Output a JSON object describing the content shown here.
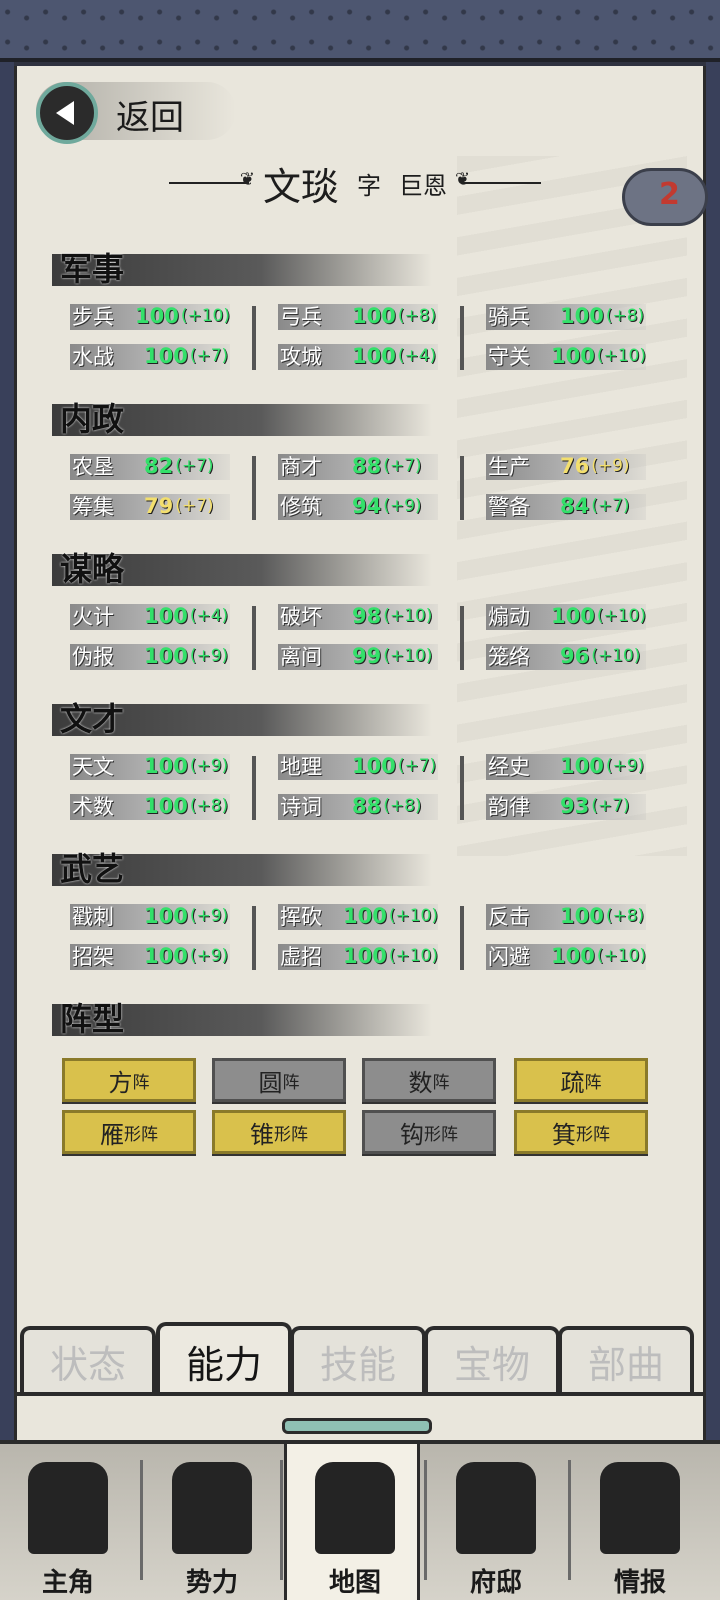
{
  "nav": {
    "back_label": "返回"
  },
  "character": {
    "name": "文琰",
    "courtesy_prefix": "字",
    "courtesy_name": "巨恩",
    "badge_number": "2"
  },
  "sections": [
    {
      "title": "军事",
      "stats": [
        {
          "label": "步兵",
          "value": "100",
          "bonus": "(+10)",
          "color": "green"
        },
        {
          "label": "弓兵",
          "value": "100",
          "bonus": "(+8)",
          "color": "green"
        },
        {
          "label": "骑兵",
          "value": "100",
          "bonus": "(+8)",
          "color": "green"
        },
        {
          "label": "水战",
          "value": "100",
          "bonus": "(+7)",
          "color": "green"
        },
        {
          "label": "攻城",
          "value": "100",
          "bonus": "(+4)",
          "color": "green"
        },
        {
          "label": "守关",
          "value": "100",
          "bonus": "(+10)",
          "color": "green"
        }
      ]
    },
    {
      "title": "内政",
      "stats": [
        {
          "label": "农垦",
          "value": "82",
          "bonus": "(+7)",
          "color": "green"
        },
        {
          "label": "商才",
          "value": "88",
          "bonus": "(+7)",
          "color": "green"
        },
        {
          "label": "生产",
          "value": "76",
          "bonus": "(+9)",
          "color": "yellow"
        },
        {
          "label": "筹集",
          "value": "79",
          "bonus": "(+7)",
          "color": "yellow"
        },
        {
          "label": "修筑",
          "value": "94",
          "bonus": "(+9)",
          "color": "green"
        },
        {
          "label": "警备",
          "value": "84",
          "bonus": "(+7)",
          "color": "green"
        }
      ]
    },
    {
      "title": "谋略",
      "stats": [
        {
          "label": "火计",
          "value": "100",
          "bonus": "(+4)",
          "color": "green"
        },
        {
          "label": "破坏",
          "value": "98",
          "bonus": "(+10)",
          "color": "green"
        },
        {
          "label": "煽动",
          "value": "100",
          "bonus": "(+10)",
          "color": "green"
        },
        {
          "label": "伪报",
          "value": "100",
          "bonus": "(+9)",
          "color": "green"
        },
        {
          "label": "离间",
          "value": "99",
          "bonus": "(+10)",
          "color": "green"
        },
        {
          "label": "笼络",
          "value": "96",
          "bonus": "(+10)",
          "color": "green"
        }
      ]
    },
    {
      "title": "文才",
      "stats": [
        {
          "label": "天文",
          "value": "100",
          "bonus": "(+9)",
          "color": "green"
        },
        {
          "label": "地理",
          "value": "100",
          "bonus": "(+7)",
          "color": "green"
        },
        {
          "label": "经史",
          "value": "100",
          "bonus": "(+9)",
          "color": "green"
        },
        {
          "label": "术数",
          "value": "100",
          "bonus": "(+8)",
          "color": "green"
        },
        {
          "label": "诗词",
          "value": "88",
          "bonus": "(+8)",
          "color": "green"
        },
        {
          "label": "韵律",
          "value": "93",
          "bonus": "(+7)",
          "color": "green"
        }
      ]
    },
    {
      "title": "武艺",
      "stats": [
        {
          "label": "戳刺",
          "value": "100",
          "bonus": "(+9)",
          "color": "green"
        },
        {
          "label": "挥砍",
          "value": "100",
          "bonus": "(+10)",
          "color": "green"
        },
        {
          "label": "反击",
          "value": "100",
          "bonus": "(+8)",
          "color": "green"
        },
        {
          "label": "招架",
          "value": "100",
          "bonus": "(+9)",
          "color": "green"
        },
        {
          "label": "虚招",
          "value": "100",
          "bonus": "(+10)",
          "color": "green"
        },
        {
          "label": "闪避",
          "value": "100",
          "bonus": "(+10)",
          "color": "green"
        }
      ]
    }
  ],
  "formation_section": {
    "title": "阵型"
  },
  "formations": [
    {
      "main": "方",
      "suffix": "阵",
      "state": "on"
    },
    {
      "main": "圆",
      "suffix": "阵",
      "state": "off"
    },
    {
      "main": "数",
      "suffix": "阵",
      "state": "off"
    },
    {
      "main": "疏",
      "suffix": "阵",
      "state": "on"
    },
    {
      "main": "雁",
      "suffix": "形阵",
      "state": "on"
    },
    {
      "main": "锥",
      "suffix": "形阵",
      "state": "on"
    },
    {
      "main": "钩",
      "suffix": "形阵",
      "state": "off"
    },
    {
      "main": "箕",
      "suffix": "形阵",
      "state": "on"
    }
  ],
  "tabs": [
    {
      "label": "状态",
      "active": false
    },
    {
      "label": "能力",
      "active": true
    },
    {
      "label": "技能",
      "active": false
    },
    {
      "label": "宝物",
      "active": false
    },
    {
      "label": "部曲",
      "active": false
    }
  ],
  "bottom_nav": [
    {
      "label": "主角",
      "icon": "hero-icon",
      "active": false
    },
    {
      "label": "势力",
      "icon": "banner-flag-icon",
      "active": false
    },
    {
      "label": "地图",
      "icon": "map-icon",
      "active": true
    },
    {
      "label": "府邸",
      "icon": "mansion-icon",
      "active": false
    },
    {
      "label": "情报",
      "icon": "scroll-book-icon",
      "active": false
    }
  ],
  "colors": {
    "green": "#33e06a",
    "yellow": "#f3df6e",
    "gold_button": "#d9c14c",
    "gray_button": "#8d8d8d"
  }
}
